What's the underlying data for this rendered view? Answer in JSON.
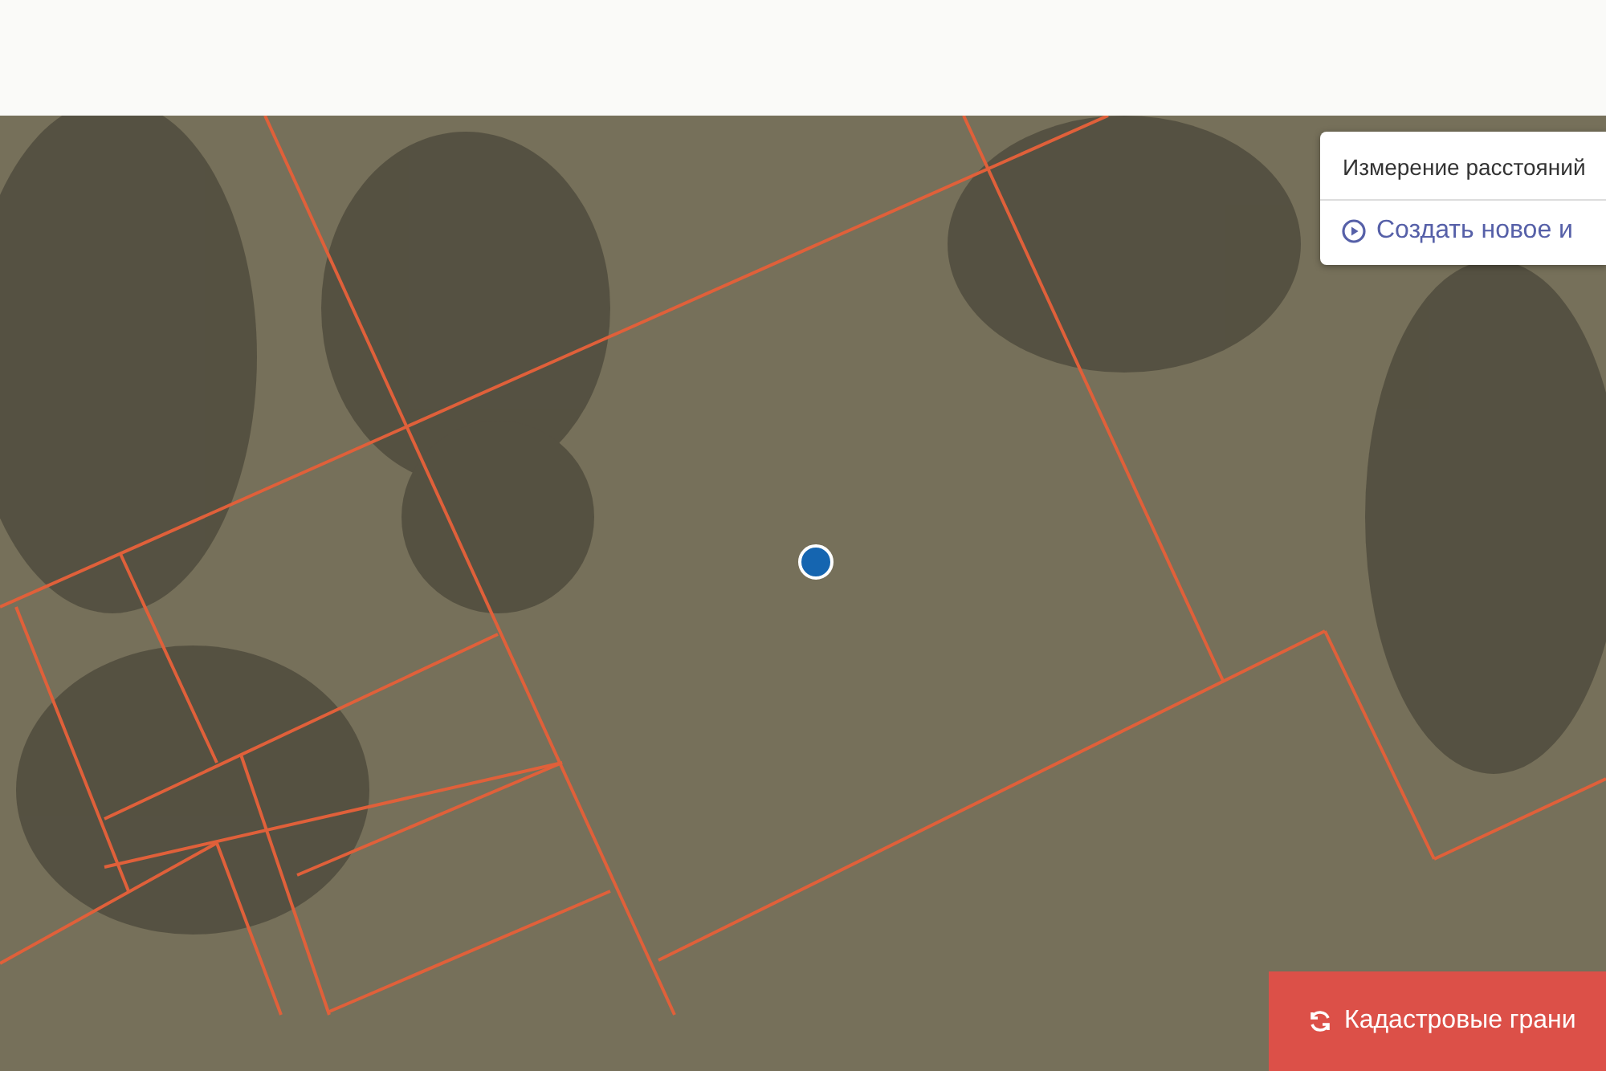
{
  "measure_panel": {
    "title": "Измерение расстояний",
    "action": "Создать новое и"
  },
  "cadastral_button": {
    "label": "Кадастровые грани"
  }
}
